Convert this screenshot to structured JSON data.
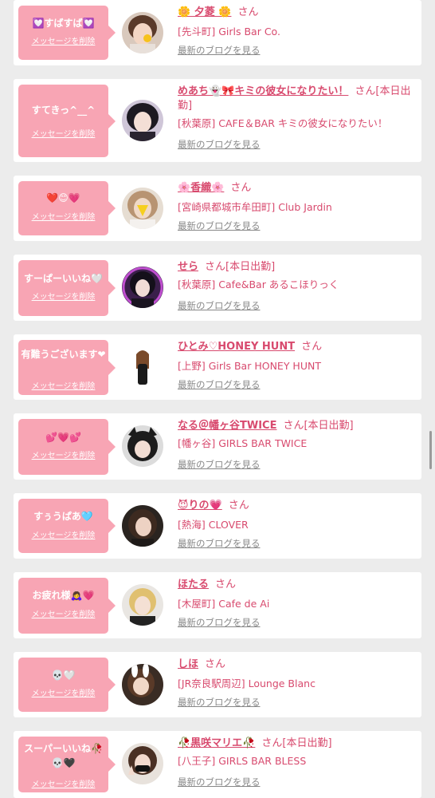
{
  "delete_label": "メッセージを削除",
  "blog_label": "最新のブログを見る",
  "san_label": "さん",
  "colors": {
    "accent": "#d84a6e",
    "bubble": "#f8a5b4",
    "background": "#ececec",
    "card": "#ffffff"
  },
  "entries": [
    {
      "message": "💟すばすば💟",
      "name": "🌼 夕菱 🌼",
      "status": "",
      "shop": "[先斗町] Girls Bar Co."
    },
    {
      "message": "すてきっ^__^",
      "name": "めあち👻🎀キミの彼女になりたい！",
      "status": "[本日出勤]",
      "shop": "[秋葉原] CAFE＆BAR キミの彼女になりたい！"
    },
    {
      "message": "❤️😊💗",
      "name": "🌸香織🌸",
      "status": "",
      "shop": "[宮崎県都城市牟田町] Club Jardin"
    },
    {
      "message": "すーぱーいいね🤍",
      "name": "せら",
      "status": "[本日出勤]",
      "shop": "[秋葉原] Cafe&Bar あるこほりっく"
    },
    {
      "message": "有難うございます❤",
      "name": "ひとみ♡HONEY HUNT",
      "status": "",
      "shop": "[上野] Girls Bar HONEY HUNT"
    },
    {
      "message": "💕💗💕",
      "name": "なる＠幡ヶ谷TWICE",
      "status": "[本日出勤]",
      "shop": "[幡ヶ谷] GIRLS BAR TWICE"
    },
    {
      "message": "すぅうぱあ🩵",
      "name": "😈りの💗",
      "status": "",
      "shop": "[熱海] CLOVER"
    },
    {
      "message": "お疲れ様🙇‍♀️💗",
      "name": "ほたる",
      "status": "",
      "shop": "[木屋町] Cafe de Ai"
    },
    {
      "message": "💀🤍",
      "name": "しほ",
      "status": "",
      "shop": "[JR奈良駅周辺] Lounge Blanc"
    },
    {
      "message": "スーパーいいね🥀💀🖤",
      "name": "🥀黒咲マリエ🥀",
      "status": "[本日出勤]",
      "shop": "[八王子] GIRLS BAR BLESS"
    }
  ]
}
